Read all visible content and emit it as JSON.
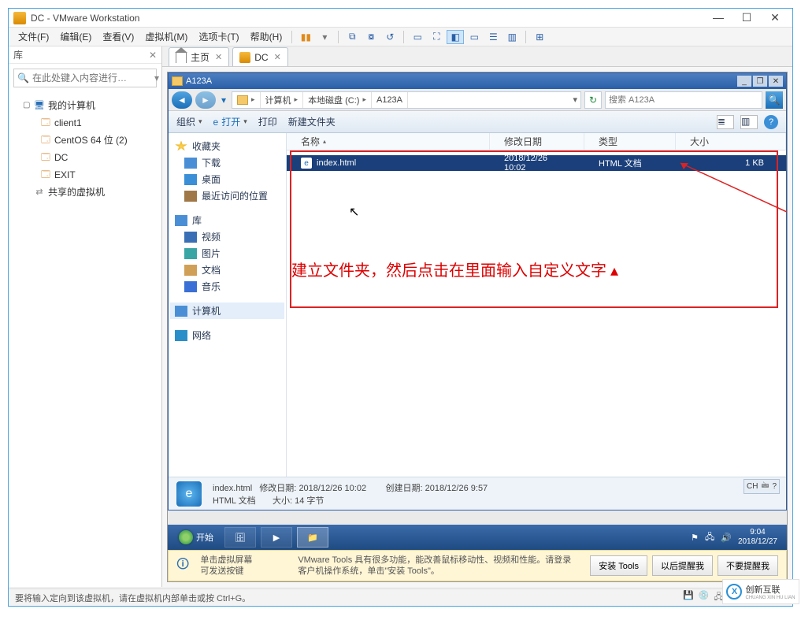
{
  "window": {
    "title": "DC - VMware Workstation"
  },
  "menu": {
    "file": "文件(F)",
    "edit": "编辑(E)",
    "view": "查看(V)",
    "vm": "虚拟机(M)",
    "tabs": "选项卡(T)",
    "help": "帮助(H)"
  },
  "library": {
    "title": "库",
    "search_placeholder": "在此处键入内容进行…",
    "nodes": {
      "root": "我的计算机",
      "n1": "client1",
      "n2": "CentOS 64 位 (2)",
      "n3": "DC",
      "n4": "EXIT",
      "shared": "共享的虚拟机"
    }
  },
  "tabs": {
    "home": "主页",
    "dc": "DC"
  },
  "explorer": {
    "title": "A123A",
    "crumbs": {
      "c1": "计算机",
      "c2": "本地磁盘 (C:)",
      "c3": "A123A"
    },
    "search_placeholder": "搜索 A123A",
    "toolbar": {
      "org": "组织",
      "open": "打开",
      "print": "打印",
      "newfolder": "新建文件夹"
    },
    "cols": {
      "name": "名称",
      "date": "修改日期",
      "type": "类型",
      "size": "大小"
    },
    "side": {
      "fav": "收藏夹",
      "dl": "下载",
      "desk": "桌面",
      "recent": "最近访问的位置",
      "lib": "库",
      "vid": "视频",
      "pic": "图片",
      "doc": "文档",
      "mus": "音乐",
      "comp": "计算机",
      "net": "网络"
    },
    "rows": [
      {
        "name": "index.html",
        "date": "2018/12/26 10:02",
        "type": "HTML 文档",
        "size": "1 KB"
      }
    ],
    "status": {
      "fname": "index.html",
      "mod_lbl": "修改日期:",
      "mod_val": "2018/12/26 10:02",
      "created_lbl": "创建日期:",
      "created_val": "2018/12/26 9:57",
      "ftype": "HTML 文档",
      "size_lbl": "大小:",
      "size_val": "14 字节",
      "lang": "CH"
    },
    "annotation": "建立文件夹，然后点击在里面输入自定义文字 ▴"
  },
  "taskbar": {
    "start": "开始",
    "clock_time": "9:04",
    "clock_date": "2018/12/27"
  },
  "vmbar": {
    "hint1a": "单击虚拟屏幕",
    "hint1b": "可发送按键",
    "hint2a": "VMware Tools 具有很多功能，能改善鼠标移动性、视频和性能。请登录",
    "hint2b": "客户机操作系统，单击\"安装 Tools\"。",
    "btn1": "安装 Tools",
    "btn2": "以后提醒我",
    "btn3": "不要提醒我"
  },
  "statusbar": "要将输入定向到该虚拟机，请在虚拟机内部单击或按 Ctrl+G。",
  "watermark": {
    "brand": "创新互联",
    "sub": "CHUANG XIN HU LIAN"
  }
}
